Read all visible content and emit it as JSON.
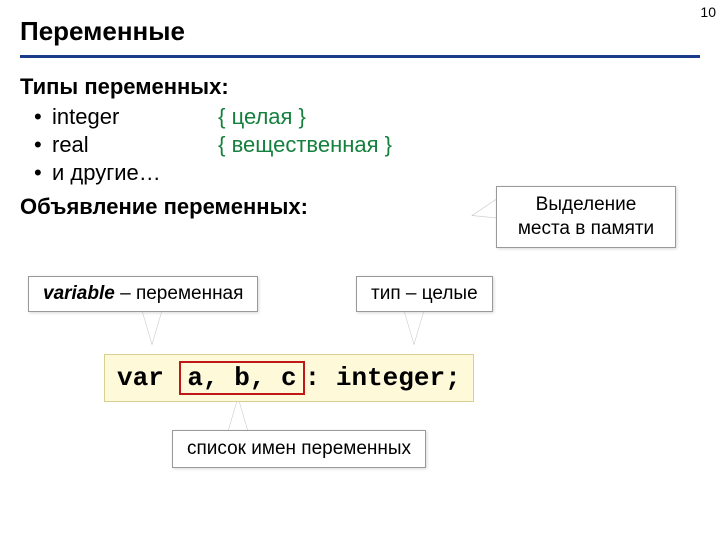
{
  "pageNumber": "10",
  "title": "Переменные",
  "typesHeading": "Типы переменных:",
  "types": [
    {
      "name": "integer",
      "desc": "{ целая }"
    },
    {
      "name": "real",
      "desc": "{ вещественная }"
    },
    {
      "name": "и другие…",
      "desc": ""
    }
  ],
  "declHeading": "Объявление переменных:",
  "callouts": {
    "memory": "Выделение места в памяти",
    "variableWord": "variable",
    "variableDash": " – переменная",
    "typeLabel": "тип – целые",
    "namesList": "список имен переменных"
  },
  "code": {
    "kw": "var ",
    "vars": "a, b, c",
    "colon": ": ",
    "type": "integer;"
  }
}
